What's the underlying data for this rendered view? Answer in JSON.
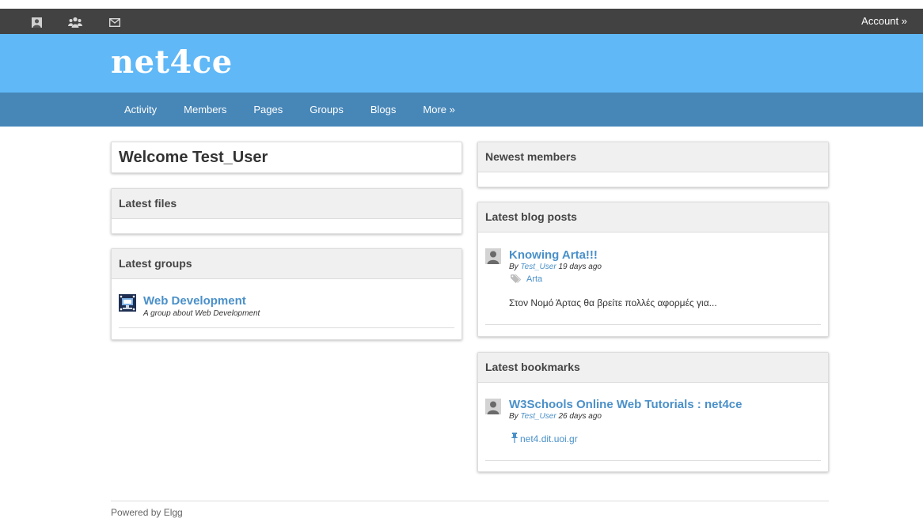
{
  "topbar": {
    "icons": [
      "profile-icon",
      "friends-icon",
      "messages-icon"
    ],
    "account_label": "Account »"
  },
  "header": {
    "site_name": "net4ce"
  },
  "nav": {
    "items": [
      "Activity",
      "Members",
      "Pages",
      "Groups",
      "Blogs",
      "More »"
    ]
  },
  "welcome": {
    "text": "Welcome Test_User"
  },
  "latest_files": {
    "title": "Latest files"
  },
  "latest_groups": {
    "title": "Latest groups",
    "items": [
      {
        "name": "Web Development",
        "description": "A group about Web Development"
      }
    ]
  },
  "newest_members": {
    "title": "Newest members"
  },
  "latest_blog_posts": {
    "title": "Latest blog posts",
    "items": [
      {
        "title": "Knowing Arta!!!",
        "by": "By",
        "author": "Test_User",
        "time": "19 days ago",
        "tag": "Arta",
        "excerpt": "Στον Νομό Άρτας θα βρείτε πολλές αφορμές για..."
      }
    ]
  },
  "latest_bookmarks": {
    "title": "Latest bookmarks",
    "items": [
      {
        "title": "W3Schools Online Web Tutorials : net4ce",
        "by": "By",
        "author": "Test_User",
        "time": "26 days ago",
        "link": "net4.dit.uoi.gr"
      }
    ]
  },
  "footer": {
    "text": "Powered by Elgg"
  },
  "colors": {
    "topbar": "#424242",
    "header": "#60b8f7",
    "nav": "#4787b8",
    "link": "#4a90c9"
  }
}
